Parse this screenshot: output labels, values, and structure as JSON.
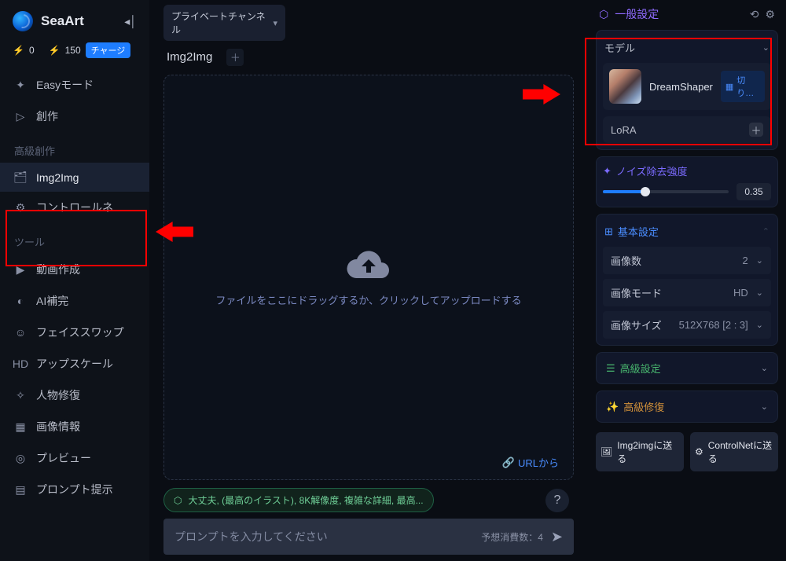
{
  "brand": {
    "name": "SeaArt"
  },
  "credits": {
    "bolt1": "0",
    "bolt2": "150",
    "chip": "チャージ"
  },
  "nav": {
    "easy": "Easyモード",
    "create": "創作",
    "adv_label": "高級創作",
    "img2img": "Img2Img",
    "controlnet": "コントロールネ...",
    "tools_label": "ツール",
    "video": "動画作成",
    "aicomp": "AI補完",
    "faceswap": "フェイススワップ",
    "upscale": "アップスケール",
    "restore": "人物修復",
    "imginfo": "画像情報",
    "preview": "プレビュー",
    "ptip": "プロンプト提示"
  },
  "top": {
    "private": "プライベートチャンネル",
    "tab": "Img2Img"
  },
  "canvas": {
    "text": "ファイルをここにドラッグするか、クリックしてアップロードする",
    "url": "URLから"
  },
  "pill": "大丈夫, (最高のイラスト), 8K解像度, 複雑な詳細, 最高...",
  "prompt": {
    "placeholder": "プロンプトを入力してください",
    "meta": "予想消費数：4"
  },
  "panel": {
    "title": "一般設定",
    "model_label": "モデル",
    "model_name": "DreamShaper",
    "switch": "切り…",
    "lora": "LoRA",
    "noise_label": "ノイズ除去強度",
    "noise_value": "0.35",
    "basic": "基本設定",
    "count_label": "画像数",
    "count_val": "2",
    "mode_label": "画像モード",
    "mode_val": "HD",
    "size_label": "画像サイズ",
    "size_val": "512X768   [2 : 3]",
    "adv": "高級設定",
    "repair": "高級修復",
    "send_img2img": "Img2imgに送る",
    "send_controlnet": "ControlNetに送る"
  }
}
